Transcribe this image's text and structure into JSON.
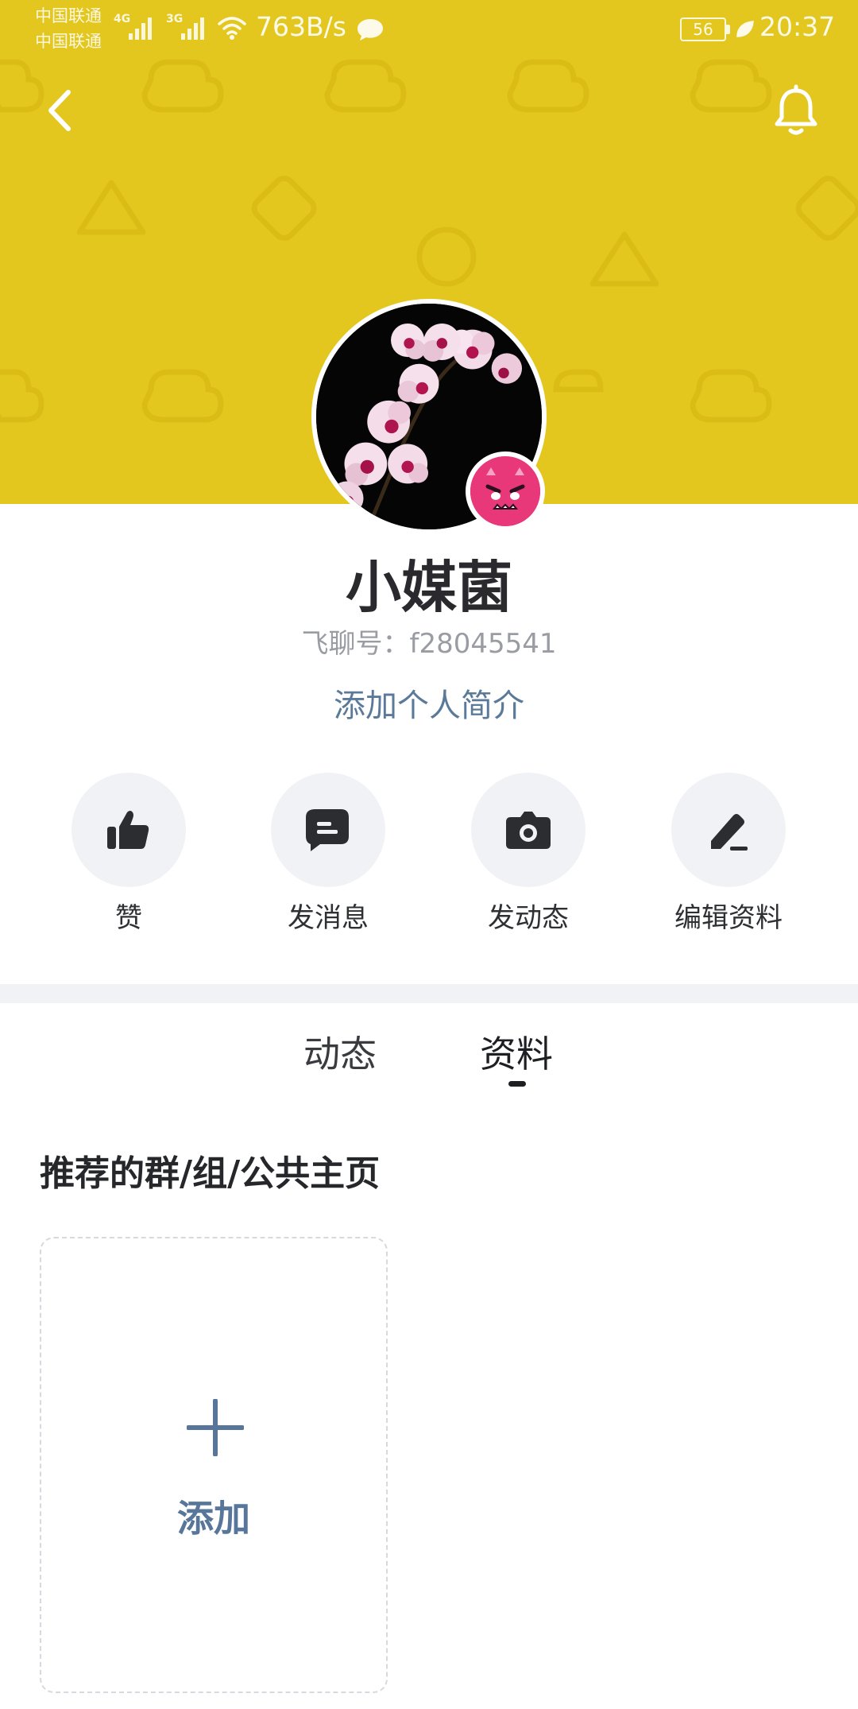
{
  "status_bar": {
    "carrier_1": "中国联通",
    "carrier_2": "中国联通",
    "network_1": "4G",
    "network_2": "3G",
    "net_speed": "763B/s",
    "battery": "56",
    "time": "20:37",
    "icons": [
      "signal-icon",
      "wifi-icon",
      "chat-bubble-icon",
      "battery-icon",
      "leaf-icon"
    ]
  },
  "header": {
    "background_color": "#e3c71f",
    "back_icon": "chevron-left-icon",
    "bell_icon": "bell-icon"
  },
  "profile": {
    "username": "小媒菌",
    "account_id": "飞聊号：f28045541",
    "add_bio": "添加个人简介",
    "avatar": "orchid-photo",
    "badge": "devil-face-icon"
  },
  "actions": [
    {
      "label": "赞",
      "icon": "thumbs-up-icon"
    },
    {
      "label": "发消息",
      "icon": "message-icon"
    },
    {
      "label": "发动态",
      "icon": "camera-icon"
    },
    {
      "label": "编辑资料",
      "icon": "pencil-icon"
    }
  ],
  "tabs": [
    {
      "label": "动态",
      "active": false
    },
    {
      "label": "资料",
      "active": true
    }
  ],
  "section": {
    "title": "推荐的群/组/公共主页",
    "add_label": "添加",
    "add_icon": "plus-icon",
    "accent_color": "#57769a"
  }
}
